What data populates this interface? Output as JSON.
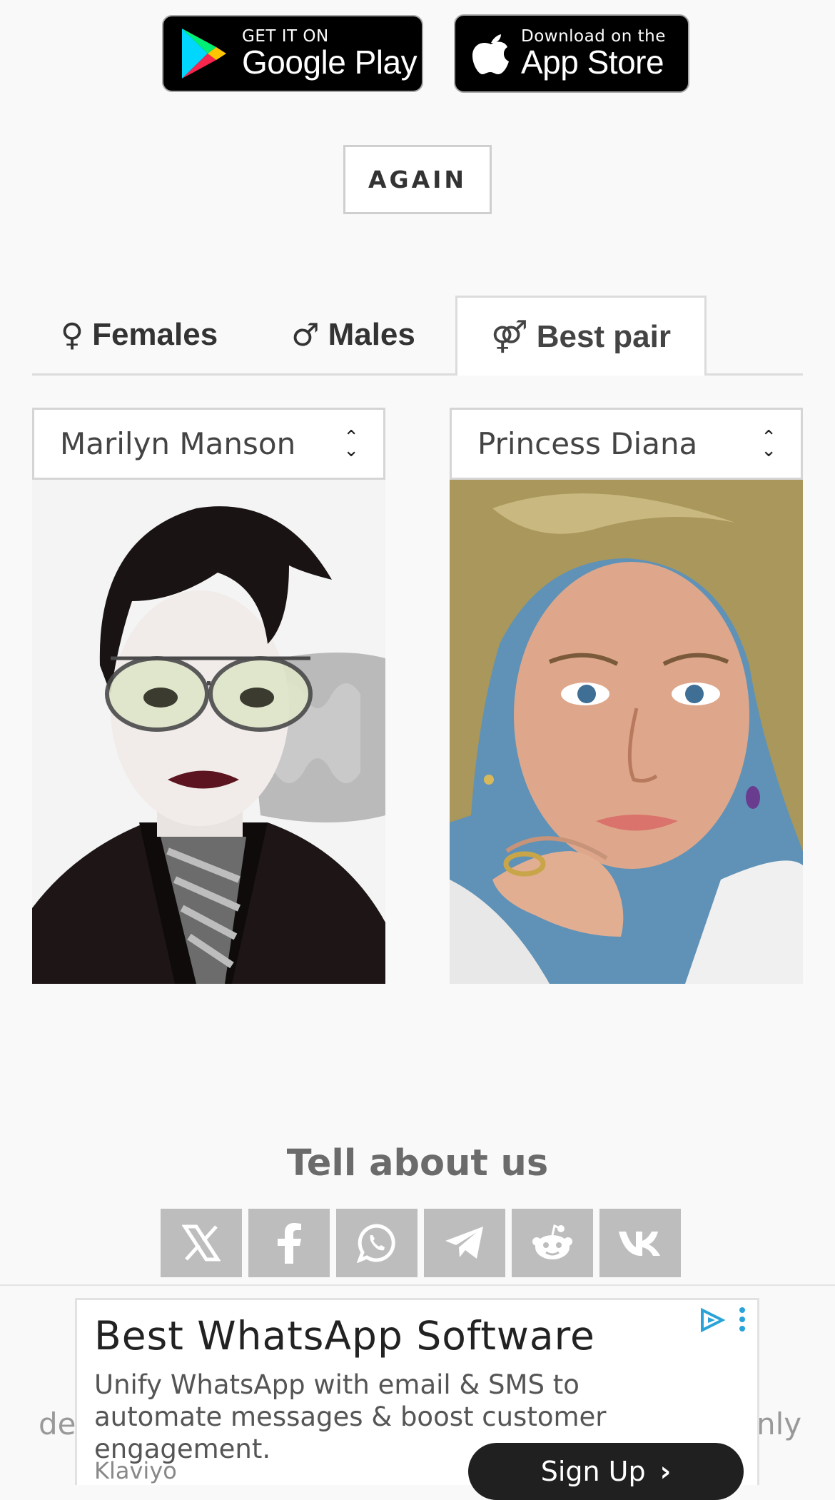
{
  "store_badges": {
    "google_play": {
      "small": "GET IT ON",
      "big": "Google Play"
    },
    "app_store": {
      "small": "Download on the",
      "big": "App Store"
    }
  },
  "again_button": "AGAIN",
  "tabs": [
    {
      "symbol": "♀",
      "label": "Females",
      "active": false
    },
    {
      "symbol": "♂",
      "label": "Males",
      "active": false
    },
    {
      "symbol": "⚤",
      "label": "Best pair",
      "active": true
    }
  ],
  "pair": {
    "left_select": "Marilyn Manson",
    "right_select": "Princess Diana"
  },
  "share": {
    "heading": "Tell about us",
    "networks": [
      "x-icon",
      "facebook-icon",
      "whatsapp-icon",
      "telegram-icon",
      "reddit-icon",
      "vk-icon"
    ]
  },
  "background_text": {
    "left": "de",
    "right": "nly"
  },
  "ad": {
    "title": "Best WhatsApp Software",
    "description": "Unify WhatsApp with email & SMS to automate messages & boost customer engagement.",
    "brand": "Klaviyo",
    "cta": "Sign Up"
  }
}
